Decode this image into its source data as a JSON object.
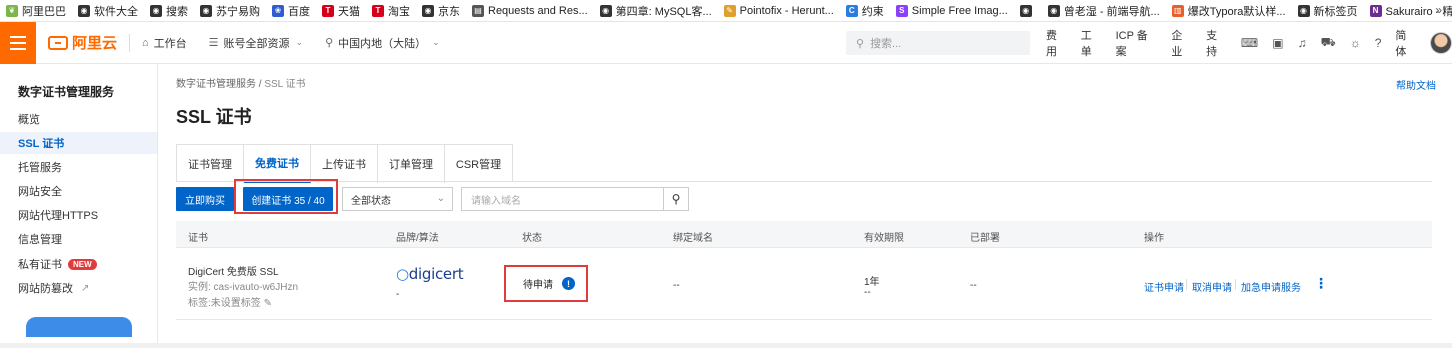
{
  "bookmarks": [
    {
      "label": "阿里巴巴",
      "icon": "alibaba-leaf-icon",
      "color": "#7ab648"
    },
    {
      "label": "软件大全",
      "icon": "globe-icon",
      "color": "#333333"
    },
    {
      "label": "搜索",
      "icon": "globe-icon",
      "color": "#333333"
    },
    {
      "label": "苏宁易购",
      "icon": "globe-icon",
      "color": "#333333"
    },
    {
      "label": "百度",
      "icon": "baidu-paw-icon",
      "color": "#2f5ccf"
    },
    {
      "label": "天猫",
      "icon": "tmall-icon",
      "color": "#d7001b"
    },
    {
      "label": "淘宝",
      "icon": "taobao-icon",
      "color": "#d7001b"
    },
    {
      "label": "京东",
      "icon": "globe-icon",
      "color": "#333333"
    },
    {
      "label": "Requests and Res...",
      "icon": "doc-icon",
      "color": "#555555"
    },
    {
      "label": "第四章: MySQL客...",
      "icon": "globe-icon",
      "color": "#333333"
    },
    {
      "label": "Pointofix - Herunt...",
      "icon": "pointofix-icon",
      "color": "#e0a030"
    },
    {
      "label": "约束",
      "icon": "c-icon",
      "color": "#2a7de1"
    },
    {
      "label": "Simple Free Imag...",
      "icon": "s-icon",
      "color": "#8a3ffc"
    },
    {
      "label": "",
      "icon": "globe-icon",
      "color": "#333333"
    },
    {
      "label": "曾老湿 - 前端导航...",
      "icon": "globe-icon",
      "color": "#333333"
    },
    {
      "label": "爆改Typora默认样...",
      "icon": "typora-icon",
      "color": "#e8602c"
    },
    {
      "label": "新标签页",
      "icon": "globe-icon",
      "color": "#333333"
    },
    {
      "label": "Sakurairo - 精致唯...",
      "icon": "n-icon",
      "color": "#6b2d8f"
    }
  ],
  "bookmarks_more": "»",
  "topnav": {
    "logo_text": "阿里云",
    "workbench": "工作台",
    "account_scope": "账号全部资源",
    "region": "中国内地（大陆）",
    "search_placeholder": "搜索...",
    "links": [
      "费用",
      "工单",
      "ICP 备案",
      "企业",
      "支持"
    ],
    "lang": "简体"
  },
  "sidebar": {
    "title": "数字证书管理服务",
    "items": [
      {
        "label": "概览",
        "active": false
      },
      {
        "label": "SSL 证书",
        "active": true
      },
      {
        "label": "托管服务",
        "active": false
      },
      {
        "label": "网站安全",
        "active": false
      },
      {
        "label": "网站代理HTTPS",
        "active": false
      },
      {
        "label": "信息管理",
        "active": false
      },
      {
        "label": "私有证书",
        "active": false,
        "badge": "NEW"
      },
      {
        "label": "网站防篡改",
        "active": false,
        "external": true
      }
    ]
  },
  "main": {
    "breadcrumb": [
      "数字证书管理服务",
      "/",
      "SSL 证书"
    ],
    "help_link": "帮助文档",
    "title": "SSL 证书",
    "tabs": [
      {
        "label": "证书管理",
        "active": false
      },
      {
        "label": "免费证书",
        "active": true
      },
      {
        "label": "上传证书",
        "active": false
      },
      {
        "label": "订单管理",
        "active": false
      },
      {
        "label": "CSR管理",
        "active": false
      }
    ],
    "toolbar": {
      "buy_label": "立即购买",
      "create_label": "创建证书 35 / 40",
      "status_filter": "全部状态",
      "domain_placeholder": "请输入域名"
    },
    "table": {
      "headers": [
        "证书",
        "品牌/算法",
        "状态",
        "绑定域名",
        "有效期限",
        "已部署",
        "操作"
      ],
      "rows": [
        {
          "name": "DigiCert 免费版 SSL",
          "instance": "实例: cas-ivauto-w6JHzn",
          "tag": "标签:未设置标签",
          "brand": "digicert",
          "algorithm": "-",
          "status": "待申请",
          "domain": "--",
          "validity": "1年",
          "validity_sub": "--",
          "deployed": "--",
          "actions": [
            "证书申请",
            "取消申请",
            "加急申请服务"
          ]
        }
      ]
    }
  },
  "colors": {
    "brand_orange": "#ff6a00",
    "primary_blue": "#0064c8",
    "highlight_red": "#e23b3b"
  }
}
